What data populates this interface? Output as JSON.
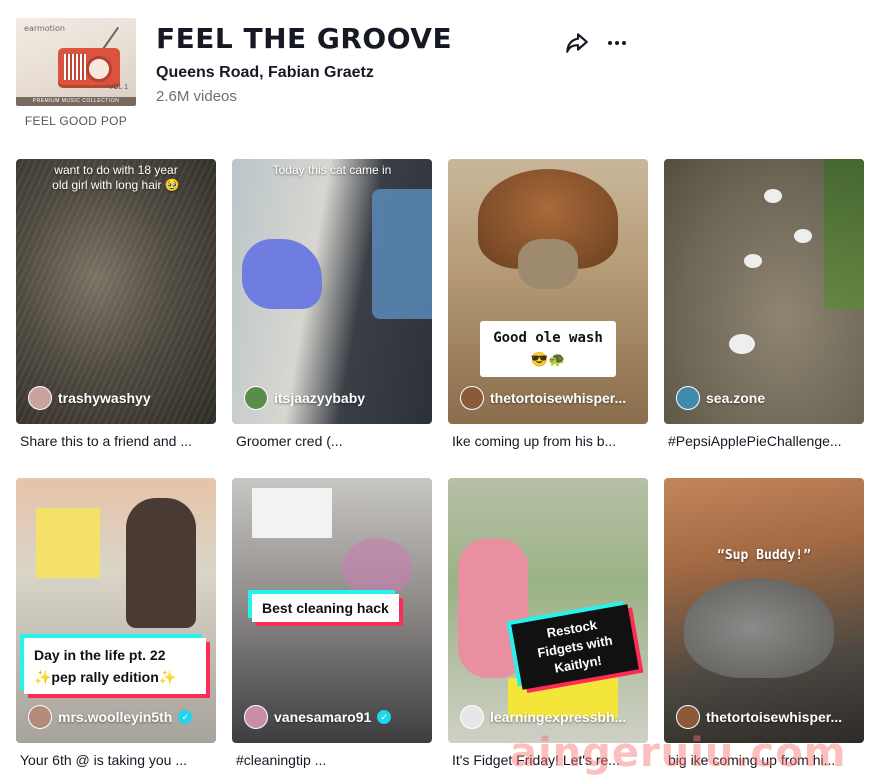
{
  "header": {
    "cover_brand": "earmotion",
    "cover_vol": "VOL 1",
    "cover_strip": "PREMIUM MUSIC COLLECTION",
    "cover_caption": "FEEL GOOD POP",
    "title": "FEEL THE GROOVE",
    "artist": "Queens Road, Fabian Graetz",
    "video_count": "2.6M videos",
    "share_icon": "share-icon",
    "more_icon": "more-icon"
  },
  "videos": [
    {
      "username": "trashywashyy",
      "verified": false,
      "caption": "want to do with 18 year old girl with long hair 🥹",
      "description": "Share this to a friend and ...",
      "avatar_color": "#c9a2a0"
    },
    {
      "username": "itsjaazyybaby",
      "verified": false,
      "caption": "Today this cat came in",
      "description": "Groomer cred (...",
      "avatar_color": "#5b8d4a"
    },
    {
      "username": "thetortoisewhisper...",
      "verified": false,
      "caption": "Good ole wash 😎🐢",
      "description": "Ike coming up from his b...",
      "avatar_color": "#8a5a3b"
    },
    {
      "username": "sea.zone",
      "verified": false,
      "caption": "",
      "description": "#PepsiApplePieChallenge...",
      "avatar_color": "#3f8bb0"
    },
    {
      "username": "mrs.woolleyin5th",
      "verified": true,
      "caption": "Day in the life pt. 22 ✨pep rally edition✨",
      "description": "Your 6th @ is taking you ...",
      "avatar_color": "#b28b7a"
    },
    {
      "username": "vanesamaro91",
      "verified": true,
      "caption": "Best cleaning hack",
      "description": "#cleaningtip ...",
      "avatar_color": "#c58fa8"
    },
    {
      "username": "learningexpressbh...",
      "verified": false,
      "caption": "Restock Fidgets with Kaitlyn!",
      "description": "It's Fidget Friday! Let's re...",
      "avatar_color": "#e7e7e7"
    },
    {
      "username": "thetortoisewhisper...",
      "verified": false,
      "caption": "“Sup Buddy!”",
      "description": "big ike coming up from hi...",
      "avatar_color": "#8a5a3b"
    }
  ],
  "watermark": "aingeruiu.com"
}
